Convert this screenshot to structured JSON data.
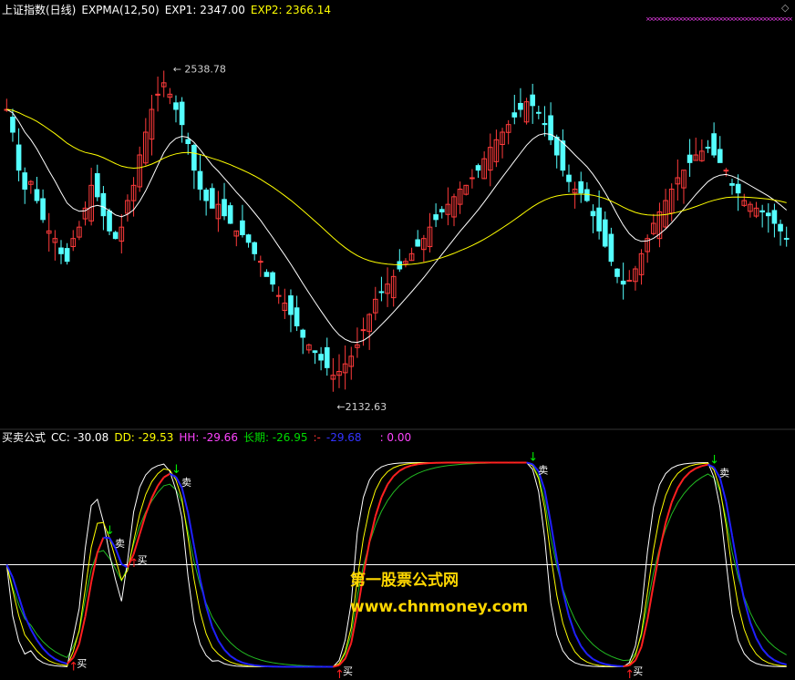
{
  "upper_panel": {
    "title": "上证指数(日线)",
    "indicator": "EXPMA(12,50)",
    "exp1_label": "EXP1: 2347.00",
    "exp2_label": "EXP2: 2366.14",
    "high_label": "2538.78",
    "low_label": "2132.63",
    "colors": {
      "up": "#ff3b3b",
      "down": "#54ffff",
      "exp1": "#ffffff",
      "exp2": "#ffff00",
      "label": "#d0d0d0"
    }
  },
  "lower_panel": {
    "title": "买卖公式",
    "cc_label": "CC: -30.08",
    "dd_label": "DD: -29.53",
    "hh_label": "HH: -29.66",
    "long_label": "长期: -26.95",
    "dash_label": ":-",
    "v_label": "-29.68",
    "zero_label": ": 0.00",
    "buy_text": "买",
    "sell_text": "卖",
    "colors": {
      "cc": "#ffffff",
      "dd": "#ffff00",
      "hh": "#ff44ff",
      "long": "#00dd00",
      "v": "#3333ff",
      "pink": "#ff44ff",
      "red": "#ff2020",
      "blue": "#2020ff",
      "green": "#22bb22"
    }
  },
  "watermark": {
    "line1": "第一股票公式网",
    "line2": "www.chnmoney.com"
  },
  "chart_data": [
    {
      "type": "candlestick",
      "title": "上证指数(日线)",
      "annotations": {
        "high": 2538.78,
        "low": 2132.63
      },
      "ylim": [
        2080,
        2620
      ],
      "closes": [
        2500,
        2470,
        2420,
        2395,
        2405,
        2380,
        2355,
        2340,
        2330,
        2310,
        2300,
        2330,
        2345,
        2370,
        2400,
        2385,
        2360,
        2340,
        2330,
        2345,
        2380,
        2400,
        2440,
        2470,
        2500,
        2520,
        2535,
        2520,
        2500,
        2480,
        2455,
        2420,
        2395,
        2380,
        2370,
        2375,
        2360,
        2350,
        2340,
        2335,
        2325,
        2310,
        2300,
        2280,
        2270,
        2255,
        2245,
        2230,
        2215,
        2200,
        2190,
        2180,
        2170,
        2160,
        2150,
        2155,
        2165,
        2175,
        2190,
        2210,
        2230,
        2250,
        2260,
        2270,
        2280,
        2290,
        2300,
        2310,
        2320,
        2330,
        2345,
        2355,
        2365,
        2375,
        2385,
        2395,
        2400,
        2410,
        2420,
        2435,
        2450,
        2460,
        2470,
        2480,
        2490,
        2500,
        2510,
        2505,
        2495,
        2480,
        2460,
        2440,
        2420,
        2405,
        2395,
        2390,
        2380,
        2360,
        2340,
        2320,
        2300,
        2280,
        2270,
        2275,
        2290,
        2310,
        2330,
        2350,
        2365,
        2380,
        2395,
        2410,
        2420,
        2430,
        2440,
        2445,
        2450,
        2440,
        2430,
        2420,
        2400,
        2390,
        2380,
        2375,
        2370,
        2365,
        2360,
        2350,
        2340,
        2330
      ]
    },
    {
      "type": "line",
      "title": "买卖公式",
      "series": [
        {
          "name": "CC",
          "last": -30.08
        },
        {
          "name": "DD",
          "last": -29.53
        },
        {
          "name": "HH",
          "last": -29.66
        },
        {
          "name": "长期",
          "last": -26.95
        },
        {
          "name": "",
          "last": -29.68
        }
      ],
      "reference_line": 0.0,
      "ylim": [
        -100,
        100
      ]
    }
  ]
}
